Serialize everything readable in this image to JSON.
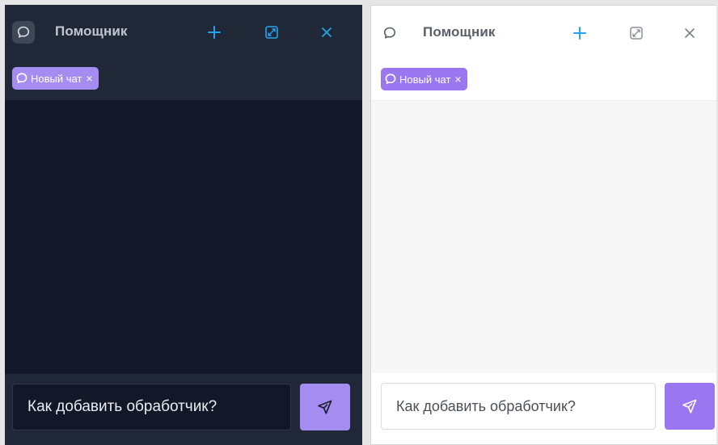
{
  "panels": [
    {
      "theme": "dark",
      "header": {
        "title": "Помощник"
      },
      "tabs": [
        {
          "label": "Новый чат",
          "close_glyph": "×"
        }
      ],
      "input": {
        "value": "Как добавить обработчик?"
      },
      "icons": {
        "avatar": "chat-bubble-icon",
        "new": "plus-icon",
        "expand": "expand-icon",
        "close": "close-icon",
        "send": "send-icon"
      }
    },
    {
      "theme": "light",
      "header": {
        "title": "Помощник"
      },
      "tabs": [
        {
          "label": "Новый чат",
          "close_glyph": "×"
        }
      ],
      "input": {
        "value": "Как добавить обработчик?"
      },
      "icons": {
        "avatar": "chat-bubble-icon",
        "new": "plus-icon",
        "expand": "expand-icon",
        "close": "close-icon",
        "send": "send-icon"
      }
    }
  ],
  "colors": {
    "dark_bg": "#121827",
    "dark_header": "#202736",
    "light_bg": "#ffffff",
    "light_messages": "#f7f7f7",
    "accent_plus": "#22a2f2",
    "accent_purple_dark": "#a48cf1",
    "accent_purple_light": "#9a77f0"
  }
}
